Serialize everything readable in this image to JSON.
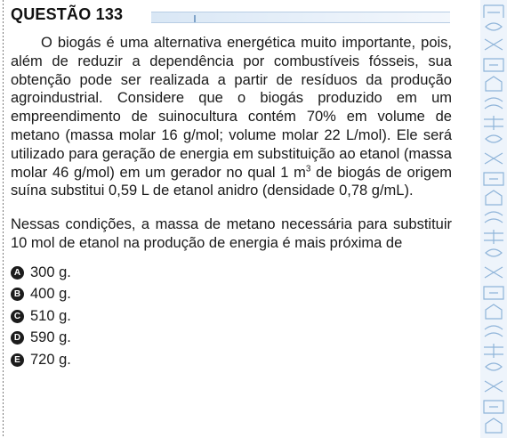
{
  "header": {
    "title": "QUESTÃO 133"
  },
  "stem": {
    "part1": "O biogás é uma alternativa energética muito importante, pois, além de reduzir a dependência por combustíveis fósseis, sua obtenção pode ser realizada a partir de resíduos da produção agroindustrial. Considere que o biogás produzido em um empreendimento de suinocultura contém 70% em volume de metano (massa molar 16 g/mol; volume molar 22 L/mol). Ele será utilizado para geração de energia em substituição ao etanol (massa molar 46 g/mol) em um gerador no qual 1 m",
    "superscript": "3",
    "part2": " de biogás de origem suína substitui 0,59 L de etanol anidro (densidade 0,78 g/mL)."
  },
  "question": "Nessas condições, a massa de metano necessária para substituir 10 mol de etanol na produção de energia é mais próxima de",
  "options": [
    {
      "letter": "A",
      "text": "300 g."
    },
    {
      "letter": "B",
      "text": "400 g."
    },
    {
      "letter": "C",
      "text": "510 g."
    },
    {
      "letter": "D",
      "text": "590 g."
    },
    {
      "letter": "E",
      "text": "720 g."
    }
  ],
  "colors": {
    "title_bar": "#d9e7f5",
    "side_strip": "#eef4fb",
    "side_pattern": "#8fb4d9",
    "badge": "#1c1c1c"
  }
}
